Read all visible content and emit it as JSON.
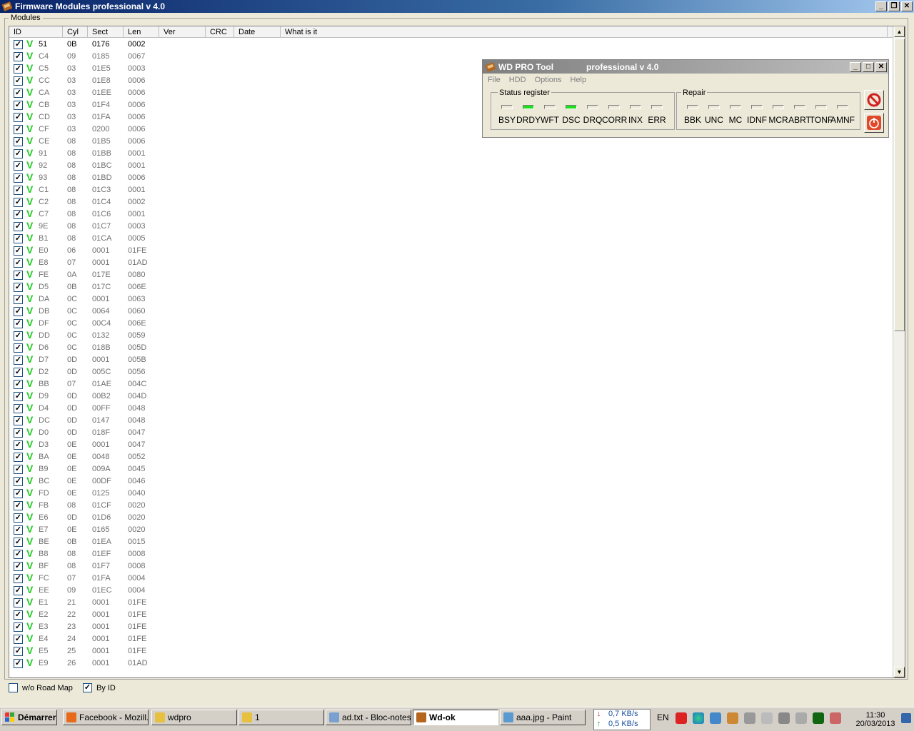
{
  "window": {
    "title": "Firmware Modules professional v 4.0"
  },
  "group": {
    "label": "Modules"
  },
  "columns": [
    "ID",
    "Cyl",
    "Sect",
    "Len",
    "Ver",
    "CRC",
    "Date",
    "What is it"
  ],
  "rows": [
    [
      "51",
      "0B",
      "0176",
      "0002"
    ],
    [
      "C4",
      "09",
      "0185",
      "0067"
    ],
    [
      "C5",
      "03",
      "01E5",
      "0003"
    ],
    [
      "CC",
      "03",
      "01E8",
      "0006"
    ],
    [
      "CA",
      "03",
      "01EE",
      "0006"
    ],
    [
      "CB",
      "03",
      "01F4",
      "0006"
    ],
    [
      "CD",
      "03",
      "01FA",
      "0006"
    ],
    [
      "CF",
      "03",
      "0200",
      "0006"
    ],
    [
      "CE",
      "08",
      "01B5",
      "0006"
    ],
    [
      "91",
      "08",
      "01BB",
      "0001"
    ],
    [
      "92",
      "08",
      "01BC",
      "0001"
    ],
    [
      "93",
      "08",
      "01BD",
      "0006"
    ],
    [
      "C1",
      "08",
      "01C3",
      "0001"
    ],
    [
      "C2",
      "08",
      "01C4",
      "0002"
    ],
    [
      "C7",
      "08",
      "01C6",
      "0001"
    ],
    [
      "9E",
      "08",
      "01C7",
      "0003"
    ],
    [
      "B1",
      "08",
      "01CA",
      "0005"
    ],
    [
      "E0",
      "06",
      "0001",
      "01FE"
    ],
    [
      "E8",
      "07",
      "0001",
      "01AD"
    ],
    [
      "FE",
      "0A",
      "017E",
      "0080"
    ],
    [
      "D5",
      "0B",
      "017C",
      "006E"
    ],
    [
      "DA",
      "0C",
      "0001",
      "0063"
    ],
    [
      "DB",
      "0C",
      "0064",
      "0060"
    ],
    [
      "DF",
      "0C",
      "00C4",
      "006E"
    ],
    [
      "DD",
      "0C",
      "0132",
      "0059"
    ],
    [
      "D6",
      "0C",
      "018B",
      "005D"
    ],
    [
      "D7",
      "0D",
      "0001",
      "005B"
    ],
    [
      "D2",
      "0D",
      "005C",
      "0056"
    ],
    [
      "BB",
      "07",
      "01AE",
      "004C"
    ],
    [
      "D9",
      "0D",
      "00B2",
      "004D"
    ],
    [
      "D4",
      "0D",
      "00FF",
      "0048"
    ],
    [
      "DC",
      "0D",
      "0147",
      "0048"
    ],
    [
      "D0",
      "0D",
      "018F",
      "0047"
    ],
    [
      "D3",
      "0E",
      "0001",
      "0047"
    ],
    [
      "BA",
      "0E",
      "0048",
      "0052"
    ],
    [
      "B9",
      "0E",
      "009A",
      "0045"
    ],
    [
      "BC",
      "0E",
      "00DF",
      "0046"
    ],
    [
      "FD",
      "0E",
      "0125",
      "0040"
    ],
    [
      "FB",
      "08",
      "01CF",
      "0020"
    ],
    [
      "E6",
      "0D",
      "01D6",
      "0020"
    ],
    [
      "E7",
      "0E",
      "0165",
      "0020"
    ],
    [
      "BE",
      "0B",
      "01EA",
      "0015"
    ],
    [
      "B8",
      "08",
      "01EF",
      "0008"
    ],
    [
      "BF",
      "08",
      "01F7",
      "0008"
    ],
    [
      "FC",
      "07",
      "01FA",
      "0004"
    ],
    [
      "EE",
      "09",
      "01EC",
      "0004"
    ],
    [
      "E1",
      "21",
      "0001",
      "01FE"
    ],
    [
      "E2",
      "22",
      "0001",
      "01FE"
    ],
    [
      "E3",
      "23",
      "0001",
      "01FE"
    ],
    [
      "E4",
      "24",
      "0001",
      "01FE"
    ],
    [
      "E5",
      "25",
      "0001",
      "01FE"
    ],
    [
      "E9",
      "26",
      "0001",
      "01AD"
    ]
  ],
  "options": {
    "road_map": "w/o Road Map",
    "by_id": "By ID",
    "road_map_checked": false,
    "by_id_checked": true
  },
  "wd": {
    "title": "WD PRO Tool",
    "subtitle": "professional v 4.0",
    "menu": [
      "File",
      "HDD",
      "Options",
      "Help"
    ],
    "status_label": "Status register",
    "status": [
      "BSY",
      "DRDY",
      "WFT",
      "DSC",
      "DRQ",
      "CORR",
      "INX",
      "ERR"
    ],
    "status_on": [
      "DRDY",
      "DSC"
    ],
    "repair_label": "Repair",
    "repair": [
      "BBK",
      "UNC",
      "MC",
      "IDNF",
      "MCR",
      "ABRT",
      "TONF",
      "AMNF"
    ]
  },
  "taskbar": {
    "start": "Démarrer",
    "items": [
      "Facebook - Mozill...",
      "wdpro",
      "1",
      "ad.txt - Bloc-notes",
      "Wd-ok",
      "aaa.jpg - Paint"
    ],
    "active": "Wd-ok",
    "down": "0,7 KB/s",
    "up": "0,5 KB/s",
    "lang": "EN",
    "time": "11:30",
    "date": "20/03/2013"
  },
  "colors": {
    "led_on": "#1be01b",
    "check_mark": "#22cc22",
    "title_grad_start": "#0a246a"
  }
}
